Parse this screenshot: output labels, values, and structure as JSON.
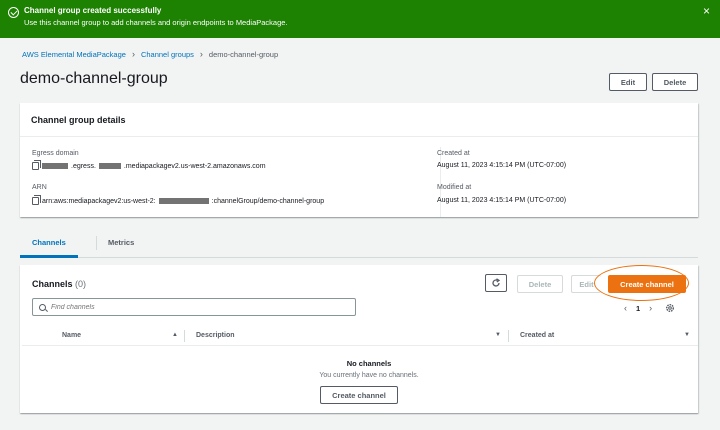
{
  "flash": {
    "title": "Channel group created successfully",
    "message": "Use this channel group to add channels and origin endpoints to MediaPackage.",
    "close_glyph": "×",
    "color": "#1d8102"
  },
  "breadcrumb": {
    "items": [
      "AWS Elemental MediaPackage",
      "Channel groups",
      "demo-channel-group"
    ],
    "sep": "›"
  },
  "page": {
    "title": "demo-channel-group",
    "edit_label": "Edit",
    "delete_label": "Delete"
  },
  "details": {
    "heading": "Channel group details",
    "egress_label": "Egress domain",
    "egress_value": ".egress.",
    "egress_value2": ".mediapackagev2.us-west-2.amazonaws.com",
    "arn_label": "ARN",
    "arn_value": "arn:aws:mediapackagev2:us-west-2:",
    "arn_value2": ":channelGroup/demo-channel-group",
    "created_label": "Created at",
    "created_value": "August 11, 2023 4:15:14 PM (UTC-07:00)",
    "modified_label": "Modified at",
    "modified_value": "August 11, 2023 4:15:14 PM (UTC-07:00)"
  },
  "tabs": [
    {
      "label": "Channels",
      "active": true
    },
    {
      "label": "Metrics",
      "active": false
    }
  ],
  "channels": {
    "heading": "Channels",
    "count": "(0)",
    "refresh_icon": "refresh-icon",
    "delete_label": "Delete",
    "edit_label": "Edit",
    "create_label": "Create channel",
    "search_placeholder": "Find channels",
    "page_number": "1",
    "prev_glyph": "‹",
    "next_glyph": "›",
    "settings_icon": "gear-icon",
    "columns": [
      {
        "label": "Name",
        "sort": "▲"
      },
      {
        "label": "Description",
        "sort": "▼"
      },
      {
        "label": "Created at",
        "sort": "▼"
      }
    ],
    "empty_title": "No channels",
    "empty_message": "You currently have no channels.",
    "empty_button": "Create channel"
  },
  "colors": {
    "accent": "#0073bb",
    "primary": "#ec7211"
  }
}
